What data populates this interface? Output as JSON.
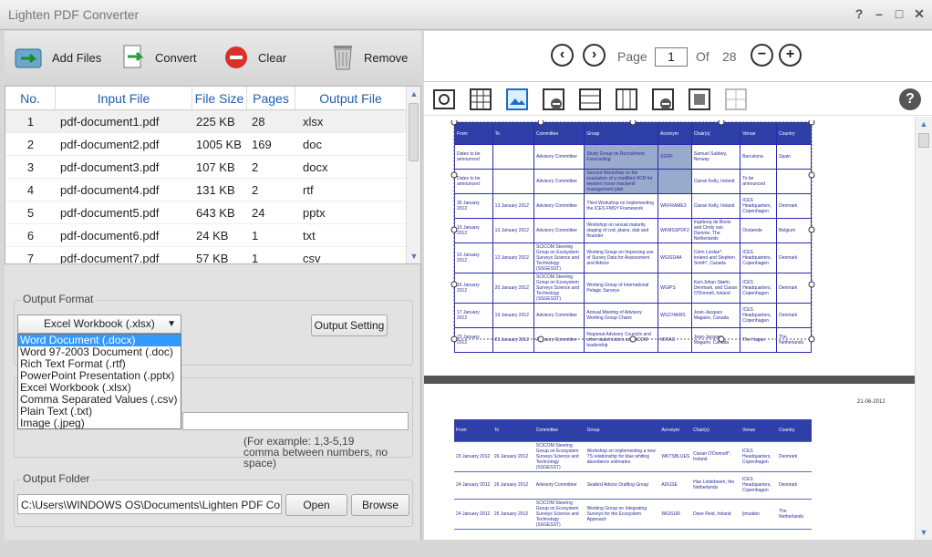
{
  "window": {
    "title": "Lighten PDF Converter",
    "controls": [
      "?",
      "–",
      "□",
      "✕"
    ]
  },
  "toolbar": {
    "add_files": "Add Files",
    "convert": "Convert",
    "clear": "Clear",
    "remove": "Remove"
  },
  "table": {
    "headers": [
      "No.",
      "Input File",
      "File Size",
      "Pages",
      "Output File"
    ],
    "rows": [
      [
        "1",
        "pdf-document1.pdf",
        "225 KB",
        "28",
        "xlsx"
      ],
      [
        "2",
        "pdf-document2.pdf",
        "1005 KB",
        "169",
        "doc"
      ],
      [
        "3",
        "pdf-document3.pdf",
        "107 KB",
        "2",
        "docx"
      ],
      [
        "4",
        "pdf-document4.pdf",
        "131 KB",
        "2",
        "rtf"
      ],
      [
        "5",
        "pdf-document5.pdf",
        "643 KB",
        "24",
        "pptx"
      ],
      [
        "6",
        "pdf-document6.pdf",
        "24 KB",
        "1",
        "txt"
      ],
      [
        "7",
        "pdf-document7.pdf",
        "57 KB",
        "1",
        "csv"
      ]
    ]
  },
  "output_format": {
    "label": "Output Format",
    "selected": "Excel Workbook (.xlsx)",
    "setting_button": "Output Setting",
    "options": [
      "Word Document (.docx)",
      "Word 97-2003 Document (.doc)",
      "Rich Text Format (.rtf)",
      "PowerPoint Presentation (.pptx)",
      "Excel Workbook (.xlsx)",
      "Comma Separated Values (.csv)",
      "Plain Text (.txt)",
      "Image (.jpeg)"
    ]
  },
  "page_range": {
    "hint_line1": "(For example: 1,3-5,19",
    "hint_line2": "comma between numbers, no space)"
  },
  "output_folder": {
    "label": "Output Folder",
    "path": "C:\\Users\\WINDOWS OS\\Documents\\Lighten PDF Converter",
    "open": "Open",
    "browse": "Browse"
  },
  "viewer": {
    "page_label": "Page",
    "current_page": "1",
    "of_label": "Of",
    "total_pages": "28",
    "help": "?"
  },
  "doc_page1": {
    "headers": [
      "From",
      "To",
      "Committee",
      "Group",
      "Acronym",
      "Chair(s)",
      "Venue",
      "Country"
    ],
    "rows": [
      [
        "Dates to be announced",
        "",
        "Advisory Committee",
        "Study Group on Recruitment Forecasting",
        "SGRF",
        "Samuel Subbey, Norway",
        "Barcelona",
        "Spain"
      ],
      [
        "Dates to be announced",
        "",
        "Advisory Committee",
        "Second Workshop on the evaluation of a modified HCR for western horse mackerel management plan",
        "",
        "Ciaran Kelly, Ireland",
        "To be announced",
        ""
      ],
      [
        "30 January 2012",
        "13 January 2012",
        "Advisory Committee",
        "Third Workshop on Implementing the ICES FMSY Framework",
        "WKFRAME3",
        "Ciaran Kelly, Ireland",
        "ICES Headquarters, Copenhagen",
        "Denmark"
      ],
      [
        "10 January 2012",
        "13 January 2012",
        "Advisory Committee",
        "Workshop on sexual maturity staging of cod, plaice, dab and flounder",
        "WKMSSPDF2",
        "Ingeborg de Boois and Cindy van Damme, The Netherlands",
        "Oostende",
        "Belgium"
      ],
      [
        "10 January 2012",
        "13 January 2012",
        "SCICOM Steering Group on Ecosystem Surveys Science and Technology (SSGESST)",
        "Working Group on Improving use of Survey Data for Assessment and Advice",
        "WGISDAA",
        "Colm Lordan*, Ireland and Stephen Smith*, Canada",
        "ICES Headquarters, Copenhagen",
        "Denmark"
      ],
      [
        "16 January 2012",
        "20 January 2012",
        "SCICOM Steering Group on Ecosystem Surveys Science and Technology (SSGESST)",
        "Working Group of International Pelagic Surveys",
        "WGIPS",
        "Karl-Johan Stæhr, Denmark, and Ciaran O'Donnell, Ireland",
        "ICES Headquarters, Copenhagen",
        "Denmark"
      ],
      [
        "17 January 2012",
        "19 January 2012",
        "Advisory Committee",
        "Annual Meeting of Advisory Working Group Chairs",
        "WGCHAIRS",
        "Jean-Jacques Maguire, Canada",
        "ICES Headquarters, Copenhagen",
        "Denmark"
      ],
      [
        "23 January 2012",
        "23 January 2012",
        "Advisory Committee",
        "Regional Advisory Councils and other stakeholders and ACOM leadership",
        "MIRAC",
        "Jean-Jacques Maguire, Canada",
        "The Hague",
        "The Netherlands"
      ]
    ]
  },
  "doc_page2": {
    "date": "21-06-2012",
    "headers": [
      "From",
      "To",
      "Committee",
      "Group",
      "Acronym",
      "Chair(s)",
      "Venue",
      "Country"
    ],
    "rows": [
      [
        "23 January 2012",
        "26 January 2012",
        "SCICOM Steering Group on Ecosystem Surveys Science and Technology (SSGESST)",
        "Workshop on implementing a new TS relationship for blue whiting abundance estimates",
        "WKTSBLUES",
        "Ciaran O'Donnell*, Ireland",
        "ICES Headquarters, Copenhagen",
        "Denmark"
      ],
      [
        "24 January 2012",
        "26 January 2012",
        "Advisory Committee",
        "Seabird Advice Drafting Group",
        "ADGSE",
        "Han Lindeboom, the Netherlands",
        "ICES Headquarters, Copenhagen",
        "Denmark"
      ],
      [
        "24 January 2012",
        "26 January 2012",
        "SCICOM Steering Group on Ecosystem Surveys Science and Technology (SSGESST)",
        "Working Group on Integrating Surveys for the Ecosystem Approach",
        "WGISUR",
        "Dave Reid, Ireland",
        "Ijmuiden",
        "The Netherlands"
      ]
    ]
  }
}
